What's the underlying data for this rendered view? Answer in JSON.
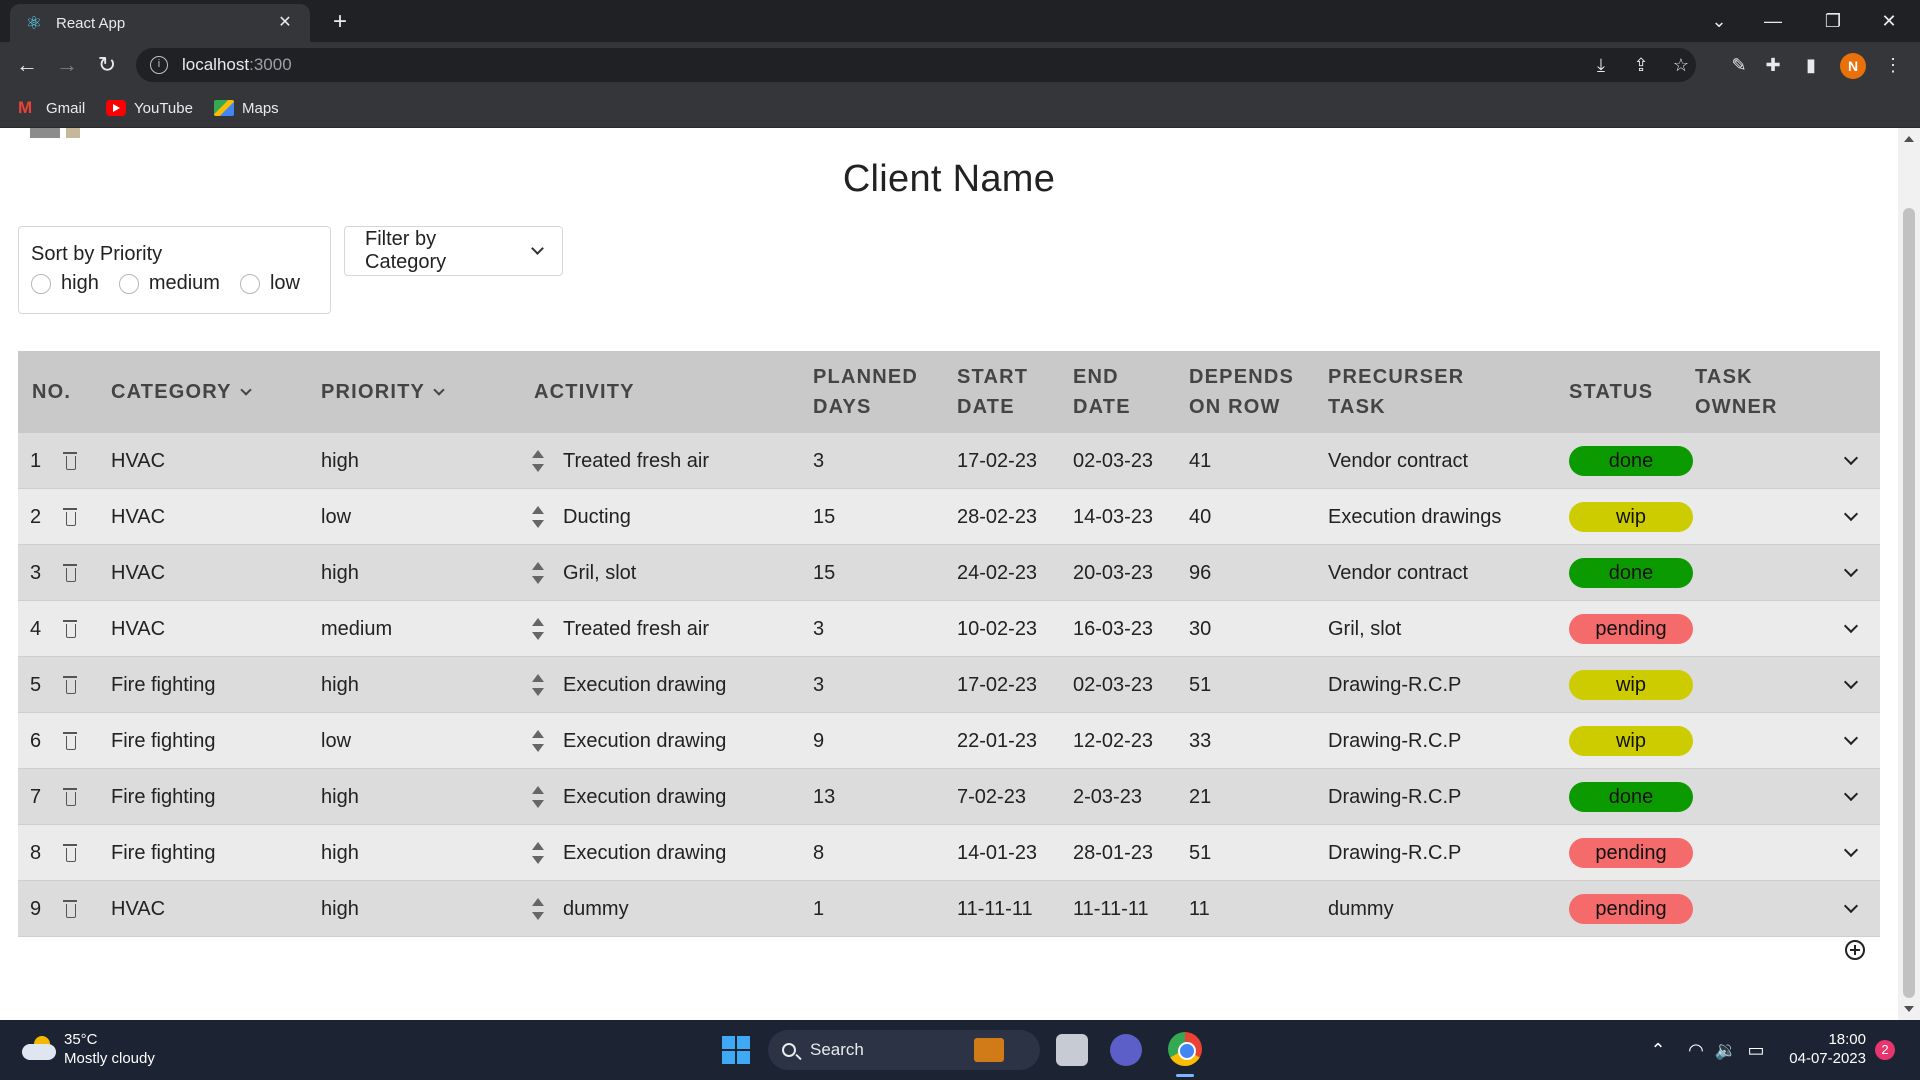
{
  "browser": {
    "tab_title": "React App",
    "url_host": "localhost",
    "url_port": ":3000",
    "bookmarks": [
      "Gmail",
      "YouTube",
      "Maps"
    ],
    "profile_initial": "N"
  },
  "page": {
    "title": "Client Name",
    "sort": {
      "label": "Sort by Priority",
      "options": [
        "high",
        "medium",
        "low"
      ]
    },
    "filter_label": "Filter by Category"
  },
  "table": {
    "headers": {
      "no": [
        "NO."
      ],
      "category": [
        "CATEGORY"
      ],
      "priority": [
        "PRIORITY"
      ],
      "activity": [
        "ACTIVITY"
      ],
      "planned": [
        "PLANNED",
        "DAYS"
      ],
      "start": [
        "START",
        "DATE"
      ],
      "end": [
        "END",
        "DATE"
      ],
      "depends": [
        "DEPENDS",
        "ON ROW"
      ],
      "precursor": [
        "PRECURSER",
        "TASK"
      ],
      "status": [
        "STATUS"
      ],
      "owner": [
        "TASK",
        "OWNER"
      ]
    },
    "rows": [
      {
        "no": "1",
        "category": "HVAC",
        "priority": "high",
        "activity": "Treated fresh air",
        "planned": "3",
        "start": "17-02-23",
        "end": "02-03-23",
        "depends": "41",
        "precursor": "Vendor contract",
        "status": "done"
      },
      {
        "no": "2",
        "category": "HVAC",
        "priority": "low",
        "activity": "Ducting",
        "planned": "15",
        "start": "28-02-23",
        "end": "14-03-23",
        "depends": "40",
        "precursor": "Execution drawings",
        "status": "wip"
      },
      {
        "no": "3",
        "category": "HVAC",
        "priority": "high",
        "activity": "Gril, slot",
        "planned": "15",
        "start": "24-02-23",
        "end": "20-03-23",
        "depends": "96",
        "precursor": "Vendor contract",
        "status": "done"
      },
      {
        "no": "4",
        "category": "HVAC",
        "priority": "medium",
        "activity": "Treated fresh air",
        "planned": "3",
        "start": "10-02-23",
        "end": "16-03-23",
        "depends": "30",
        "precursor": "Gril, slot",
        "status": "pending"
      },
      {
        "no": "5",
        "category": "Fire fighting",
        "priority": "high",
        "activity": "Execution drawing",
        "planned": "3",
        "start": "17-02-23",
        "end": "02-03-23",
        "depends": "51",
        "precursor": "Drawing-R.C.P",
        "status": "wip"
      },
      {
        "no": "6",
        "category": "Fire fighting",
        "priority": "low",
        "activity": "Execution drawing",
        "planned": "9",
        "start": "22-01-23",
        "end": "12-02-23",
        "depends": "33",
        "precursor": "Drawing-R.C.P",
        "status": "wip"
      },
      {
        "no": "7",
        "category": "Fire fighting",
        "priority": "high",
        "activity": "Execution drawing",
        "planned": "13",
        "start": "7-02-23",
        "end": "2-03-23",
        "depends": "21",
        "precursor": "Drawing-R.C.P",
        "status": "done"
      },
      {
        "no": "8",
        "category": "Fire fighting",
        "priority": "high",
        "activity": "Execution drawing",
        "planned": "8",
        "start": "14-01-23",
        "end": "28-01-23",
        "depends": "51",
        "precursor": "Drawing-R.C.P",
        "status": "pending"
      },
      {
        "no": "9",
        "category": "HVAC",
        "priority": "high",
        "activity": "dummy",
        "planned": "1",
        "start": "11-11-11",
        "end": "11-11-11",
        "depends": "11",
        "precursor": "dummy",
        "status": "pending"
      }
    ]
  },
  "status_colors": {
    "done": "#0b9a00",
    "wip": "#cccc00",
    "pending": "#f56b6b"
  },
  "taskbar": {
    "temperature": "35°C",
    "weather": "Mostly cloudy",
    "search_label": "Search",
    "time": "18:00",
    "date": "04-07-2023",
    "notification_count": "2"
  }
}
